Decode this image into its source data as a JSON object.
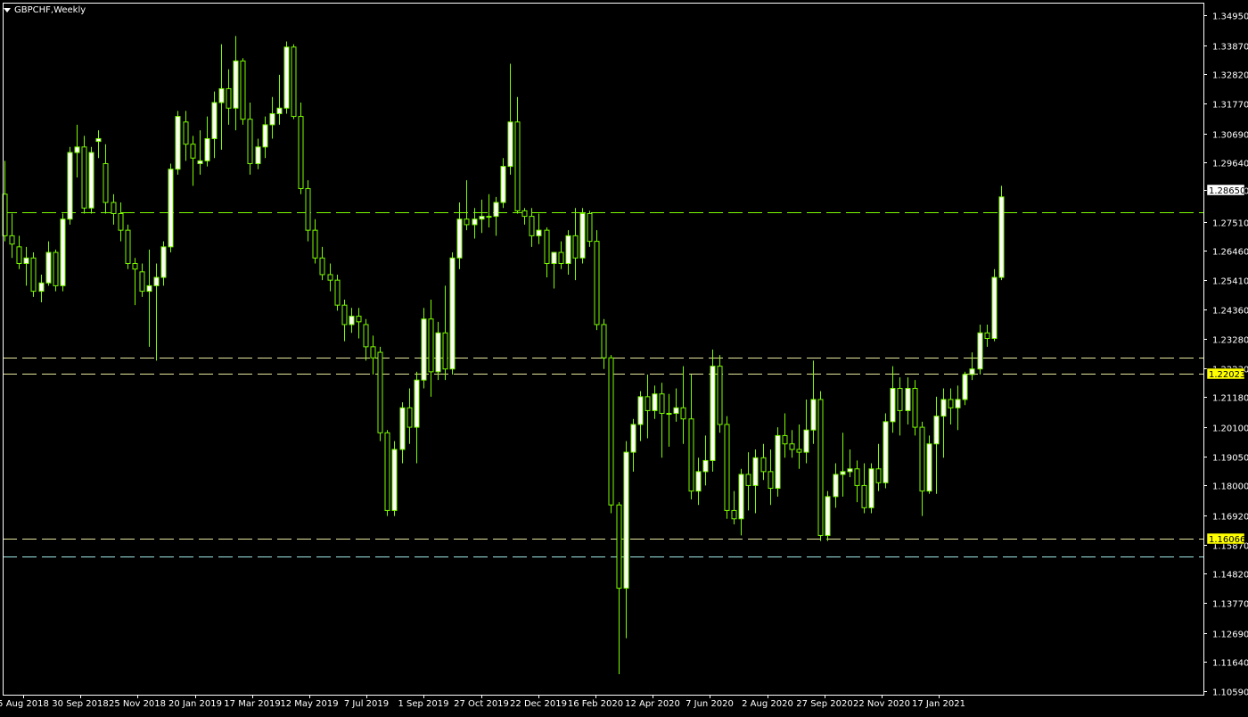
{
  "window": {
    "title": "GBPCHF,Weekly"
  },
  "colors": {
    "background": "#000000",
    "frame": "#ffffff",
    "axis_text": "#ffffff",
    "bull_body": "#ffffff",
    "bear_body": "#000000",
    "candle_outline": "#7cfc00",
    "line_green": "#7cfc00",
    "line_yellow": "#e8e8a0",
    "line_cyan": "#a0e8e8",
    "label_yellow_bg": "#ffff00",
    "label_white_bg": "#ffffff"
  },
  "chart_data": {
    "type": "candlestick",
    "symbol": "GBPCHF",
    "timeframe": "Weekly",
    "ylim": [
      1.1059,
      1.3495
    ],
    "y_ticks": [
      "1.34950",
      "1.33870",
      "1.32820",
      "1.31770",
      "1.30690",
      "1.29640",
      "1.28650",
      "1.27510",
      "1.26460",
      "1.25410",
      "1.24360",
      "1.23280",
      "1.22230",
      "1.21180",
      "1.20100",
      "1.19050",
      "1.18000",
      "1.16920",
      "1.15870",
      "1.14820",
      "1.13770",
      "1.12690",
      "1.11640",
      "1.10590"
    ],
    "x_labels": [
      "5 Aug 2018",
      "30 Sep 2018",
      "25 Nov 2018",
      "20 Jan 2019",
      "17 Mar 2019",
      "12 May 2019",
      "7 Jul 2019",
      "1 Sep 2019",
      "27 Oct 2019",
      "22 Dec 2019",
      "16 Feb 2020",
      "12 Apr 2020",
      "7 Jun 2020",
      "2 Aug 2020",
      "27 Sep 2020",
      "22 Nov 2020",
      "17 Jan 2021"
    ],
    "price_labels": [
      {
        "text": "1.28650",
        "value": 1.2865,
        "style": "white"
      },
      {
        "text": "1.22023",
        "value": 1.2202,
        "style": "yellow"
      },
      {
        "text": "1.16066",
        "value": 1.1607,
        "style": "yellow"
      }
    ],
    "levels": [
      {
        "value": 1.2785,
        "color": "green"
      },
      {
        "value": 1.226,
        "color": "yellow"
      },
      {
        "value": 1.2202,
        "color": "yellow"
      },
      {
        "value": 1.1607,
        "color": "yellow"
      },
      {
        "value": 1.1545,
        "color": "cyan"
      }
    ],
    "ohlc": [
      [
        1.285,
        1.297,
        1.268,
        1.27
      ],
      [
        1.27,
        1.278,
        1.262,
        1.267
      ],
      [
        1.266,
        1.27,
        1.258,
        1.26
      ],
      [
        1.26,
        1.266,
        1.252,
        1.262
      ],
      [
        1.262,
        1.264,
        1.248,
        1.25
      ],
      [
        1.25,
        1.256,
        1.246,
        1.253
      ],
      [
        1.253,
        1.268,
        1.252,
        1.264
      ],
      [
        1.264,
        1.265,
        1.25,
        1.252
      ],
      [
        1.252,
        1.278,
        1.25,
        1.276
      ],
      [
        1.276,
        1.302,
        1.274,
        1.3
      ],
      [
        1.3,
        1.31,
        1.291,
        1.302
      ],
      [
        1.302,
        1.306,
        1.278,
        1.28
      ],
      [
        1.28,
        1.302,
        1.278,
        1.3
      ],
      [
        1.304,
        1.308,
        1.298,
        1.305
      ],
      [
        1.296,
        1.303,
        1.278,
        1.282
      ],
      [
        1.282,
        1.285,
        1.274,
        1.278
      ],
      [
        1.278,
        1.282,
        1.268,
        1.272
      ],
      [
        1.272,
        1.274,
        1.258,
        1.26
      ],
      [
        1.26,
        1.262,
        1.245,
        1.258
      ],
      [
        1.257,
        1.26,
        1.248,
        1.25
      ],
      [
        1.25,
        1.265,
        1.23,
        1.252
      ],
      [
        1.252,
        1.26,
        1.225,
        1.255
      ],
      [
        1.255,
        1.268,
        1.252,
        1.266
      ],
      [
        1.266,
        1.296,
        1.264,
        1.294
      ],
      [
        1.294,
        1.315,
        1.292,
        1.313
      ],
      [
        1.311,
        1.315,
        1.297,
        1.303
      ],
      [
        1.303,
        1.306,
        1.288,
        1.298
      ],
      [
        1.296,
        1.308,
        1.292,
        1.297
      ],
      [
        1.297,
        1.313,
        1.295,
        1.305
      ],
      [
        1.305,
        1.322,
        1.298,
        1.318
      ],
      [
        1.318,
        1.339,
        1.301,
        1.323
      ],
      [
        1.323,
        1.33,
        1.31,
        1.316
      ],
      [
        1.316,
        1.342,
        1.308,
        1.333
      ],
      [
        1.333,
        1.334,
        1.31,
        1.312
      ],
      [
        1.312,
        1.318,
        1.292,
        1.296
      ],
      [
        1.296,
        1.305,
        1.294,
        1.302
      ],
      [
        1.302,
        1.313,
        1.298,
        1.31
      ],
      [
        1.31,
        1.32,
        1.305,
        1.314
      ],
      [
        1.314,
        1.328,
        1.31,
        1.316
      ],
      [
        1.316,
        1.34,
        1.314,
        1.338
      ],
      [
        1.338,
        1.339,
        1.312,
        1.313
      ],
      [
        1.313,
        1.318,
        1.285,
        1.287
      ],
      [
        1.287,
        1.29,
        1.268,
        1.272
      ],
      [
        1.272,
        1.276,
        1.26,
        1.262
      ],
      [
        1.262,
        1.266,
        1.254,
        1.256
      ],
      [
        1.256,
        1.26,
        1.25,
        1.254
      ],
      [
        1.254,
        1.256,
        1.243,
        1.245
      ],
      [
        1.245,
        1.247,
        1.232,
        1.238
      ],
      [
        1.238,
        1.244,
        1.235,
        1.241
      ],
      [
        1.241,
        1.244,
        1.233,
        1.239
      ],
      [
        1.238,
        1.24,
        1.225,
        1.23
      ],
      [
        1.23,
        1.234,
        1.22,
        1.226
      ],
      [
        1.228,
        1.23,
        1.196,
        1.199
      ],
      [
        1.199,
        1.2,
        1.169,
        1.171
      ],
      [
        1.171,
        1.196,
        1.169,
        1.193
      ],
      [
        1.193,
        1.21,
        1.188,
        1.208
      ],
      [
        1.208,
        1.215,
        1.195,
        1.201
      ],
      [
        1.201,
        1.221,
        1.188,
        1.218
      ],
      [
        1.218,
        1.244,
        1.215,
        1.24
      ],
      [
        1.24,
        1.247,
        1.212,
        1.221
      ],
      [
        1.221,
        1.239,
        1.218,
        1.235
      ],
      [
        1.235,
        1.252,
        1.218,
        1.222
      ],
      [
        1.222,
        1.264,
        1.22,
        1.262
      ],
      [
        1.262,
        1.282,
        1.258,
        1.276
      ],
      [
        1.276,
        1.29,
        1.272,
        1.274
      ],
      [
        1.274,
        1.28,
        1.269,
        1.276
      ],
      [
        1.276,
        1.283,
        1.271,
        1.277
      ],
      [
        1.277,
        1.285,
        1.273,
        1.277
      ],
      [
        1.277,
        1.284,
        1.27,
        1.282
      ],
      [
        1.282,
        1.298,
        1.28,
        1.295
      ],
      [
        1.295,
        1.332,
        1.292,
        1.311
      ],
      [
        1.311,
        1.32,
        1.278,
        1.279
      ],
      [
        1.279,
        1.28,
        1.274,
        1.277
      ],
      [
        1.277,
        1.28,
        1.266,
        1.27
      ],
      [
        1.27,
        1.278,
        1.267,
        1.272
      ],
      [
        1.272,
        1.273,
        1.255,
        1.26
      ],
      [
        1.26,
        1.264,
        1.251,
        1.264
      ],
      [
        1.264,
        1.268,
        1.258,
        1.26
      ],
      [
        1.26,
        1.272,
        1.256,
        1.27
      ],
      [
        1.27,
        1.28,
        1.254,
        1.262
      ],
      [
        1.262,
        1.28,
        1.26,
        1.278
      ],
      [
        1.278,
        1.279,
        1.266,
        1.268
      ],
      [
        1.268,
        1.272,
        1.236,
        1.238
      ],
      [
        1.238,
        1.24,
        1.222,
        1.226
      ],
      [
        1.226,
        1.227,
        1.17,
        1.173
      ],
      [
        1.173,
        1.174,
        1.112,
        1.143
      ],
      [
        1.143,
        1.196,
        1.125,
        1.192
      ],
      [
        1.192,
        1.204,
        1.185,
        1.202
      ],
      [
        1.202,
        1.214,
        1.196,
        1.212
      ],
      [
        1.212,
        1.22,
        1.197,
        1.207
      ],
      [
        1.207,
        1.216,
        1.204,
        1.213
      ],
      [
        1.213,
        1.217,
        1.19,
        1.206
      ],
      [
        1.206,
        1.213,
        1.194,
        1.206
      ],
      [
        1.206,
        1.215,
        1.203,
        1.208
      ],
      [
        1.208,
        1.223,
        1.195,
        1.204
      ],
      [
        1.204,
        1.22,
        1.175,
        1.178
      ],
      [
        1.178,
        1.19,
        1.173,
        1.185
      ],
      [
        1.185,
        1.198,
        1.18,
        1.189
      ],
      [
        1.189,
        1.229,
        1.185,
        1.223
      ],
      [
        1.223,
        1.227,
        1.199,
        1.202
      ],
      [
        1.202,
        1.205,
        1.168,
        1.171
      ],
      [
        1.171,
        1.178,
        1.166,
        1.168
      ],
      [
        1.168,
        1.186,
        1.162,
        1.184
      ],
      [
        1.184,
        1.192,
        1.171,
        1.18
      ],
      [
        1.18,
        1.193,
        1.17,
        1.19
      ],
      [
        1.19,
        1.195,
        1.182,
        1.185
      ],
      [
        1.185,
        1.193,
        1.173,
        1.179
      ],
      [
        1.179,
        1.201,
        1.176,
        1.198
      ],
      [
        1.198,
        1.206,
        1.19,
        1.195
      ],
      [
        1.195,
        1.2,
        1.19,
        1.193
      ],
      [
        1.193,
        1.202,
        1.186,
        1.192
      ],
      [
        1.192,
        1.211,
        1.188,
        1.2
      ],
      [
        1.2,
        1.225,
        1.195,
        1.211
      ],
      [
        1.211,
        1.214,
        1.16,
        1.162
      ],
      [
        1.162,
        1.178,
        1.16,
        1.176
      ],
      [
        1.176,
        1.188,
        1.172,
        1.184
      ],
      [
        1.184,
        1.199,
        1.176,
        1.185
      ],
      [
        1.185,
        1.193,
        1.183,
        1.186
      ],
      [
        1.186,
        1.189,
        1.174,
        1.18
      ],
      [
        1.18,
        1.188,
        1.17,
        1.172
      ],
      [
        1.172,
        1.188,
        1.17,
        1.186
      ],
      [
        1.186,
        1.195,
        1.178,
        1.181
      ],
      [
        1.181,
        1.206,
        1.179,
        1.203
      ],
      [
        1.203,
        1.223,
        1.199,
        1.215
      ],
      [
        1.215,
        1.219,
        1.198,
        1.207
      ],
      [
        1.207,
        1.219,
        1.202,
        1.215
      ],
      [
        1.215,
        1.218,
        1.198,
        1.201
      ],
      [
        1.201,
        1.203,
        1.169,
        1.178
      ],
      [
        1.178,
        1.198,
        1.177,
        1.195
      ],
      [
        1.195,
        1.212,
        1.177,
        1.205
      ],
      [
        1.205,
        1.215,
        1.19,
        1.211
      ],
      [
        1.211,
        1.215,
        1.202,
        1.208
      ],
      [
        1.208,
        1.216,
        1.2,
        1.211
      ],
      [
        1.211,
        1.221,
        1.209,
        1.22
      ],
      [
        1.22,
        1.228,
        1.218,
        1.222
      ],
      [
        1.222,
        1.238,
        1.22,
        1.235
      ],
      [
        1.235,
        1.238,
        1.23,
        1.233
      ],
      [
        1.233,
        1.258,
        1.232,
        1.255
      ],
      [
        1.255,
        1.288,
        1.254,
        1.284
      ]
    ]
  }
}
